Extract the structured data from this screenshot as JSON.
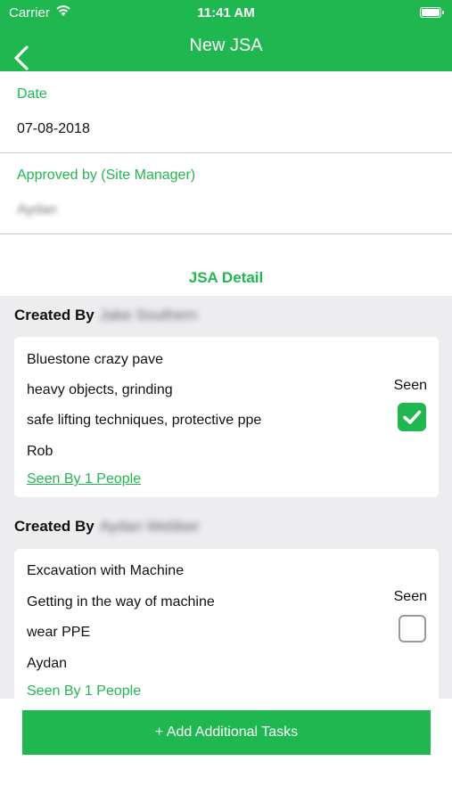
{
  "status_bar": {
    "carrier": "Carrier",
    "time": "11:41 AM"
  },
  "nav": {
    "title": "New JSA"
  },
  "form": {
    "date_label": "Date",
    "date_value": "07-08-2018",
    "approved_label": "Approved by (Site Manager)",
    "approved_value": "Aydan"
  },
  "section_title": "JSA Detail",
  "entries": [
    {
      "created_by_label": "Created By",
      "created_by_name": "Jake Southern",
      "task": "Bluestone crazy pave",
      "hazard": "heavy objects, grinding",
      "control": "safe lifting techniques, protective ppe",
      "person": "Rob",
      "seen_label": "Seen",
      "seen_checked": true,
      "seen_by": "Seen By 1 People"
    },
    {
      "created_by_label": "Created By",
      "created_by_name": "Aydan Webber",
      "task": "Excavation with Machine",
      "hazard": "Getting in the way of machine",
      "control": "wear PPE",
      "person": "Aydan",
      "seen_label": "Seen",
      "seen_checked": false,
      "seen_by": "Seen By 1 People"
    }
  ],
  "add_button": "+ Add Additional Tasks",
  "colors": {
    "accent": "#1fb850",
    "background": "#ededf0"
  },
  "icons": [
    "wifi-icon",
    "battery-icon",
    "back-chevron-icon",
    "checkbox-checked-icon",
    "checkbox-empty-icon"
  ]
}
